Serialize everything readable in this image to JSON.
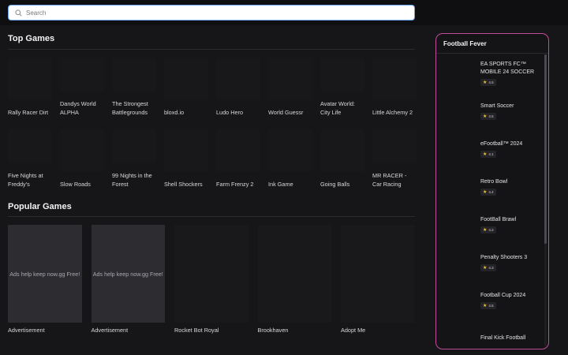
{
  "search": {
    "placeholder": "Search"
  },
  "top_games": {
    "heading": "Top Games",
    "items": [
      "Rally Racer Dirt",
      "Dandys World ALPHA",
      "The Strongest Battlegrounds",
      "bloxd.io",
      "Ludo Hero",
      "World Guessr",
      "Avatar World: City Life",
      "Little Alchemy 2",
      "Five Nights at Freddy's",
      "Slow Roads",
      "99 Nights in the Forest",
      "Shell Shockers",
      "Farm Frenzy 2",
      "Ink Game",
      "Going Balls",
      "MR RACER - Car Racing"
    ]
  },
  "popular_games": {
    "heading": "Popular Games",
    "ad_text": "Ads help keep now.gg Free!",
    "items": [
      {
        "label": "Advertisement",
        "ad": true
      },
      {
        "label": "Advertisement",
        "ad": true
      },
      {
        "label": "Rocket Bot Royal",
        "ad": false
      },
      {
        "label": "Brookhaven",
        "ad": false
      },
      {
        "label": "Adopt Me",
        "ad": false
      }
    ]
  },
  "sidebar": {
    "title": "Football Fever",
    "items": [
      {
        "name": "EA SPORTS FC™ MOBILE 24 SOCCER",
        "rating": "4.5"
      },
      {
        "name": "Smart Soccer",
        "rating": "4.5"
      },
      {
        "name": "eFootball™ 2024",
        "rating": "4.1"
      },
      {
        "name": "Retro Bowl",
        "rating": "4.4"
      },
      {
        "name": "FootBall Brawl",
        "rating": "4.2"
      },
      {
        "name": "Penalty Shooters 3",
        "rating": "4.3"
      },
      {
        "name": "Football Cup 2024",
        "rating": "4.5"
      },
      {
        "name": "Final Kick Football",
        "rating": ""
      }
    ]
  },
  "colors": {
    "panel_border": "#c04a9c",
    "search_border": "#6aa6ff",
    "star": "#f2c230"
  }
}
